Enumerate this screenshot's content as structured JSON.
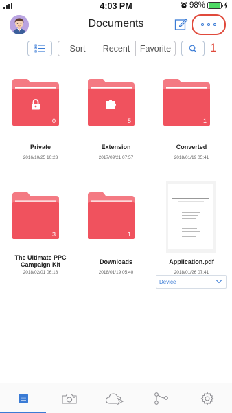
{
  "status_bar": {
    "time": "4:03 PM",
    "battery_text": "98%",
    "battery_level": 0.98
  },
  "nav": {
    "title": "Documents",
    "more_annotation": "1"
  },
  "toolbar": {
    "segments": [
      "Sort",
      "Recent",
      "Favorite"
    ]
  },
  "items": [
    {
      "name": "Private",
      "date": "2016/10/25 10:23",
      "count": "0",
      "icon": "lock-icon"
    },
    {
      "name": "Extension",
      "date": "2017/09/21 07:57",
      "count": "5",
      "icon": "puzzle-icon"
    },
    {
      "name": "Converted",
      "date": "2018/01/19 05:41",
      "count": "1",
      "icon": ""
    },
    {
      "name": "The Ultimate PPC Campaign Kit",
      "date": "2018/02/01 06:18",
      "count": "3",
      "icon": ""
    },
    {
      "name": "Downloads",
      "date": "2018/01/19 05:40",
      "count": "1",
      "icon": ""
    },
    {
      "name": "Application.pdf",
      "date": "2018/01/26 07:41",
      "count": "",
      "icon": "pdf-thumbnail"
    }
  ],
  "device_select": {
    "value": "Device"
  },
  "tabs": [
    {
      "icon": "documents-icon",
      "active": true
    },
    {
      "icon": "camera-icon",
      "active": false
    },
    {
      "icon": "cloud-icon",
      "active": false
    },
    {
      "icon": "connections-icon",
      "active": false
    },
    {
      "icon": "settings-icon",
      "active": false
    }
  ],
  "colors": {
    "folder": "#f0525e",
    "folder_light": "#f47a83",
    "accent": "#3a7bd5",
    "annotation": "#e04a3c"
  }
}
